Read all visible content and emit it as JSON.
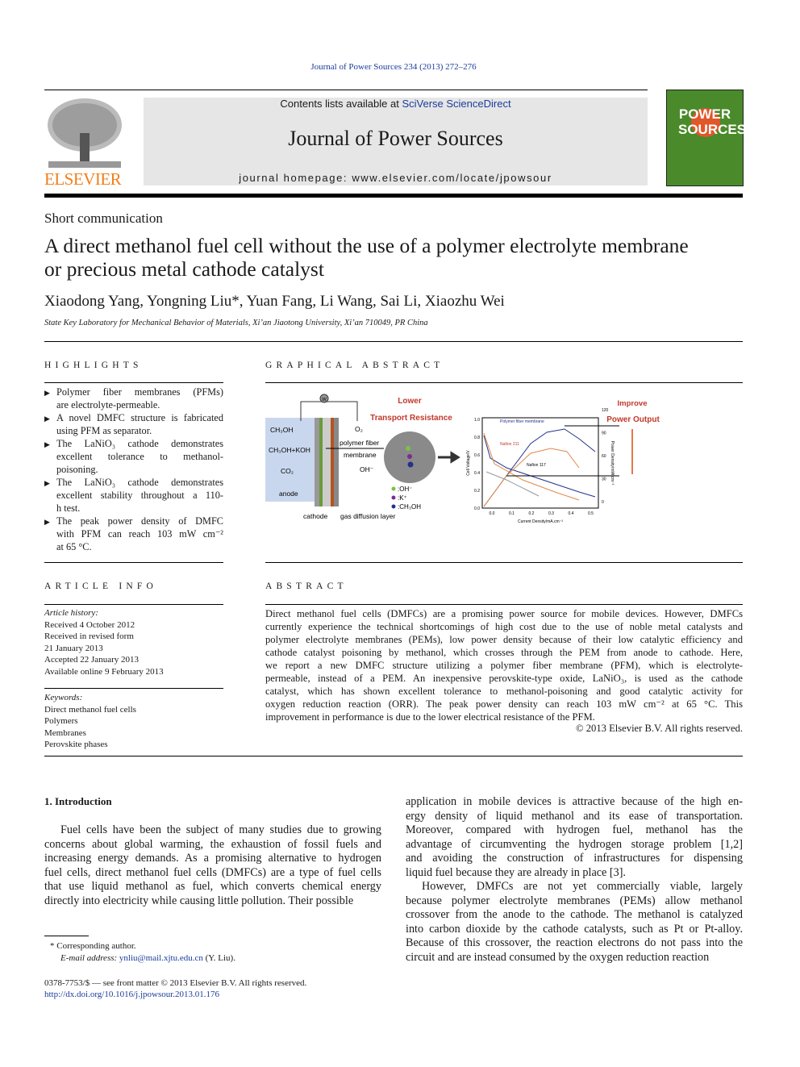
{
  "header": {
    "citation": "Journal of Power Sources 234 (2013) 272–276",
    "contents_prefix": "Contents lists available at ",
    "contents_link": "SciVerse ScienceDirect",
    "journal_title": "Journal of Power Sources",
    "homepage": "journal homepage: www.elsevier.com/locate/jpowsour",
    "publisher_logo": "ELSEVIER",
    "cover_text": "POWER SOURCES",
    "colors": {
      "link": "#1a3d9c",
      "elsevier_orange": "#f07f1a",
      "cover_green": "#4a8a2a",
      "box_gray": "#e6e6e6"
    }
  },
  "article": {
    "type": "Short communication",
    "title_lines": [
      "A direct methanol fuel cell without the use of a polymer electrolyte membrane",
      "or precious metal cathode catalyst"
    ],
    "authors": "Xiaodong Yang, Yongning Liu*, Yuan Fang, Li Wang, Sai Li, Xiaozhu Wei",
    "affiliation": "State Key Laboratory for Mechanical Behavior of Materials, Xi’an Jiaotong University, Xi’an 710049, PR China"
  },
  "highlights": {
    "heading": "HIGHLIGHTS",
    "items": [
      [
        "Polymer fiber membranes (PFMs)",
        "are electrolyte-permeable."
      ],
      [
        "A novel DMFC structure is fabricated",
        "using PFM as separator."
      ],
      [
        "The LaNiO₃ cathode demonstrates",
        "excellent tolerance to methanol-",
        "poisoning."
      ],
      [
        "The LaNiO₃ cathode demonstrates",
        "excellent stability throughout a 110-",
        "h test."
      ],
      [
        "The peak power density of DMFC",
        "with PFM can reach 103 mW cm⁻²",
        "at 65 °C."
      ]
    ]
  },
  "graphical_abstract": {
    "heading": "GRAPHICAL ABSTRACT",
    "labels": {
      "lower": "Lower",
      "transport": "Transport Resistance",
      "improve": "Improve",
      "power": "Power Output",
      "ch3oh": "CH₃OH",
      "ch3oh_koh": "CH₃OH+KOH",
      "co2": "CO₂",
      "anode": "anode",
      "cathode": "cathode",
      "gdl": "gas diffusion layer",
      "o2": "O₂",
      "oh": "OH⁻",
      "pfm1": "polymer fiber",
      "pfm2": "membrane",
      "leg_oh": ":OH⁻",
      "leg_k": ":K⁺",
      "leg_ch3oh": ":CH₃OH",
      "w": "W"
    },
    "chart": {
      "xlabel": "Current Density/mA.cm⁻²",
      "ylabel": "Cell Voltage/V",
      "y2label": "Power Density/mW.cm⁻²",
      "series_labels": [
        "Polymer fiber membrane",
        "Nafion 211",
        "Nafion 117"
      ],
      "xticks": [
        "0.0",
        "0.1",
        "0.2",
        "0.3",
        "0.4",
        "0.5"
      ],
      "yticks": [
        "0.0",
        "0.2",
        "0.4",
        "0.6",
        "0.8",
        "1.0"
      ],
      "y2ticks": [
        "0",
        "30",
        "60",
        "90",
        "120"
      ]
    }
  },
  "article_info": {
    "heading": "ARTICLE INFO",
    "history_label": "Article history:",
    "history": [
      "Received 4 October 2012",
      "Received in revised form",
      "21 January 2013",
      "Accepted 22 January 2013",
      "Available online 9 February 2013"
    ],
    "keywords_label": "Keywords:",
    "keywords": [
      "Direct methanol fuel cells",
      "Polymers",
      "Membranes",
      "Perovskite phases"
    ]
  },
  "abstract": {
    "heading": "ABSTRACT",
    "lines": [
      "Direct methanol fuel cells (DMFCs) are a promising power source for mobile devices. However, DMFCs",
      "currently experience the technical shortcomings of high cost due to the use of noble metal catalysts and",
      "polymer electrolyte membranes (PEMs), low power density because of their low catalytic efficiency and",
      "cathode catalyst poisoning by methanol, which crosses through the PEM from anode to cathode. Here,",
      "we report a new DMFC structure utilizing a polymer fiber membrane (PFM), which is electrolyte-",
      "permeable, instead of a PEM. An inexpensive perovskite-type oxide, LaNiO₃, is used as the cathode",
      "catalyst, which has shown excellent tolerance to methanol-poisoning and good catalytic activity for",
      "oxygen reduction reaction (ORR). The peak power density can reach 103 mW cm⁻² at 65 °C. This",
      "improvement in performance is due to the lower electrical resistance of the PFM."
    ],
    "copyright": "© 2013 Elsevier B.V. All rights reserved."
  },
  "body": {
    "section_heading": "1.  Introduction",
    "left_lines": [
      "Fuel cells have been the subject of many studies due to growing",
      "concerns about global warming, the exhaustion of fossil fuels and",
      "increasing energy demands. As a promising alternative to hydrogen",
      "fuel cells, direct methanol fuel cells (DMFCs) are a type of fuel cells",
      "that use liquid methanol as fuel, which converts chemical energy",
      "directly into electricity while causing little pollution. Their possible"
    ],
    "right_para1": [
      "application in mobile devices is attractive because of the high en-",
      "ergy density of liquid methanol and its ease of transportation.",
      "Moreover, compared with hydrogen fuel, methanol has the",
      "advantage of circumventing the hydrogen storage problem [1,2]",
      "and avoiding the construction of infrastructures for dispensing",
      "liquid fuel because they are already in place [3]."
    ],
    "right_para2": [
      "However, DMFCs are not yet commercially viable, largely",
      "because polymer electrolyte membranes (PEMs) allow methanol",
      "crossover from the anode to the cathode. The methanol is catalyzed",
      "into carbon dioxide by the cathode catalysts, such as Pt or Pt-alloy.",
      "Because of this crossover, the reaction electrons do not pass into the",
      "circuit and are instead consumed by the oxygen reduction reaction"
    ]
  },
  "footnote": {
    "corresponding": "*  Corresponding author.",
    "email_label": "E-mail address: ",
    "email": "ynliu@mail.xjtu.edu.cn",
    "email_suffix": " (Y. Liu).",
    "issn": "0378-7753/$ — see front matter © 2013 Elsevier B.V. All rights reserved.",
    "doi": "http://dx.doi.org/10.1016/j.jpowsour.2013.01.176"
  }
}
